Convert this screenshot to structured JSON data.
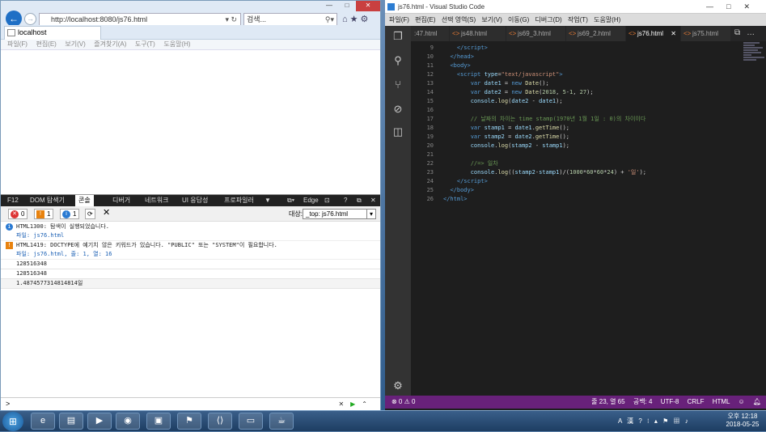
{
  "ie": {
    "url": "http://localhost:8080/js76.html",
    "search_placeholder": "검색...",
    "tab_title": "localhost",
    "menu": [
      "파일(F)",
      "편집(E)",
      "보기(V)",
      "즐겨찾기(A)",
      "도구(T)",
      "도움말(H)"
    ]
  },
  "devtools": {
    "tabs": [
      "F12",
      "DOM 탐색기",
      "콘솔",
      "디버거",
      "네트워크",
      "UI 응답성",
      "프로파일러"
    ],
    "active_tab": "콘솔",
    "edge_label": "Edge",
    "error_count": "0",
    "warning_count": "1",
    "info_count": "1",
    "target_label": "대상:",
    "target_value": "_top: js76.html",
    "messages": [
      {
        "kind": "info",
        "text": "HTML1300: 탐색이 실행되었습니다.",
        "file": "파일: js76.html"
      },
      {
        "kind": "warning",
        "text": "HTML1419: DOCTYPE에 예기치 않은 키워드가 있습니다. \"PUBLIC\" 또는 \"SYSTEM\"이 필요합니다.",
        "file": "파일: js76.html, 줄: 1, 열: 16"
      },
      {
        "kind": "log",
        "text": "128516348"
      },
      {
        "kind": "log",
        "text": "128516348"
      },
      {
        "kind": "log",
        "text": "1.4874577314814814일"
      }
    ],
    "prompt": ">"
  },
  "vscode": {
    "title": "js76.html - Visual Studio Code",
    "menu": [
      "파일(F)",
      "편집(E)",
      "선택 영역(S)",
      "보기(V)",
      "이동(G)",
      "디버그(D)",
      "작업(T)",
      "도움말(H)"
    ],
    "tabs": [
      ":47.html",
      "js48.html",
      "js69_3.html",
      "js69_2.html",
      "js76.html",
      "js75.html"
    ],
    "active_tab": "js76.html",
    "line_numbers": [
      "9",
      "10",
      "11",
      "12",
      "13",
      "14",
      "15",
      "16",
      "17",
      "18",
      "19",
      "20",
      "21",
      "22",
      "23",
      "24",
      "25",
      "26"
    ],
    "status": {
      "problems": "⊗ 0 ⚠ 0",
      "position": "줄 23, 열 65",
      "spaces": "공백: 4",
      "encoding": "UTF-8",
      "eol": "CRLF",
      "language": "HTML"
    }
  },
  "taskbar": {
    "time": "오후 12:18",
    "date": "2018-05-25",
    "ime": "A 漢"
  }
}
